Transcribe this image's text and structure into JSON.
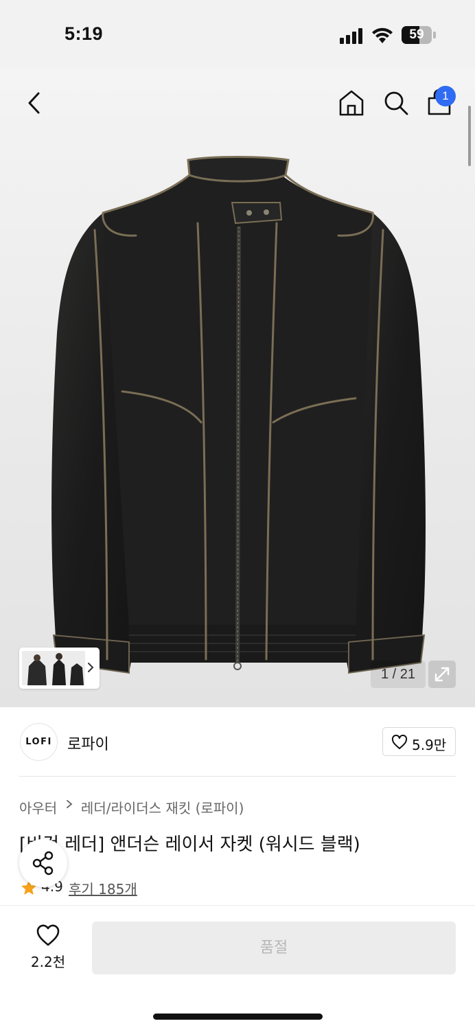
{
  "status_bar": {
    "time": "5:19",
    "battery": "59",
    "battery_level": 0.59
  },
  "header": {
    "cart_count": "1",
    "icons": [
      "back-arrow-icon",
      "home-icon",
      "search-icon",
      "shopping-bag-icon"
    ]
  },
  "gallery": {
    "counter": "1 / 21",
    "current": 1,
    "total": 21
  },
  "brand": {
    "logo_text": "LOFI",
    "name": "로파이",
    "likes": "5.9만"
  },
  "breadcrumb": [
    "아우터",
    "레더/라이더스 재킷 (로파이)"
  ],
  "product": {
    "title": "[비건 레더] 앤더슨 레이서 자켓 (워시드 블랙)",
    "rating": "4.9",
    "reviews": "후기 185개"
  },
  "bottom": {
    "wish_count": "2.2천",
    "buy_label": "품절"
  },
  "colors": {
    "accent": "#2f6bf3",
    "star": "#f7a21b",
    "disabled_bg": "#ececec",
    "disabled_text": "#b7b7b7"
  }
}
